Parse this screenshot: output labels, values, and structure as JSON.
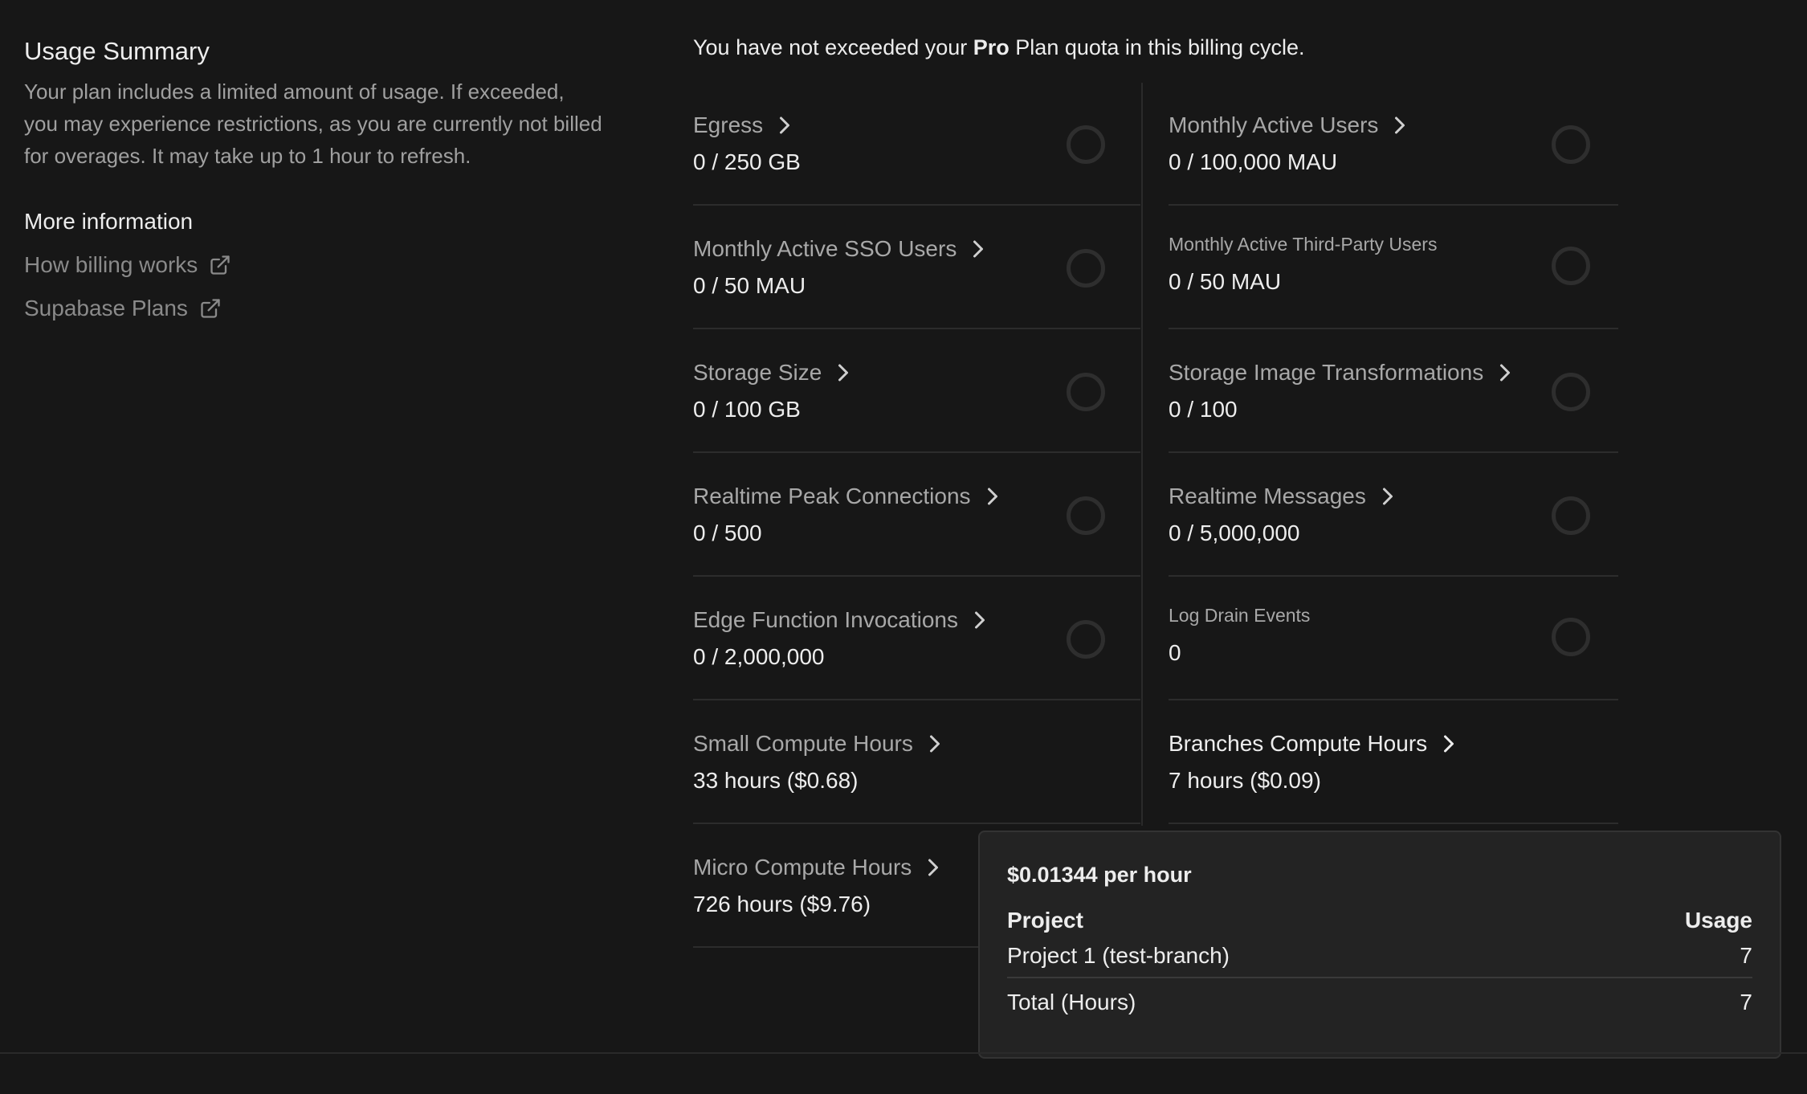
{
  "sidebar": {
    "title": "Usage Summary",
    "description": "Your plan includes a limited amount of usage. If exceeded, you may experience restrictions, as you are currently not billed for overages. It may take up to 1 hour to refresh.",
    "more_heading": "More information",
    "links": [
      {
        "label": "How billing works",
        "icon": "external-link-icon"
      },
      {
        "label": "Supabase Plans",
        "icon": "external-link-icon"
      }
    ]
  },
  "notice": {
    "prefix": "You have not exceeded your ",
    "plan": "Pro",
    "suffix": " Plan quota in this billing cycle."
  },
  "metrics": [
    {
      "label": "Egress",
      "value": "0 / 250 GB",
      "chevron": true,
      "usage_fraction": 0
    },
    {
      "label": "Monthly Active Users",
      "value": "0 / 100,000 MAU",
      "chevron": true,
      "usage_fraction": 0
    },
    {
      "label": "Monthly Active SSO Users",
      "value": "0 / 50 MAU",
      "chevron": true,
      "usage_fraction": 0
    },
    {
      "label": "Monthly Active Third-Party Users",
      "value": "0 / 50 MAU",
      "chevron": false,
      "usage_fraction": 0
    },
    {
      "label": "Storage Size",
      "value": "0 / 100 GB",
      "chevron": true,
      "usage_fraction": 0
    },
    {
      "label": "Storage Image Transformations",
      "value": "0 / 100",
      "chevron": true,
      "usage_fraction": 0
    },
    {
      "label": "Realtime Peak Connections",
      "value": "0 / 500",
      "chevron": true,
      "usage_fraction": 0
    },
    {
      "label": "Realtime Messages",
      "value": "0 / 5,000,000",
      "chevron": true,
      "usage_fraction": 0
    },
    {
      "label": "Edge Function Invocations",
      "value": "0 / 2,000,000",
      "chevron": true,
      "usage_fraction": 0
    },
    {
      "label": "Log Drain Events",
      "value": "0",
      "chevron": false,
      "usage_fraction": 0
    },
    {
      "label": "Small Compute Hours",
      "value": "33 hours ($0.68)",
      "chevron": true
    },
    {
      "label": "Branches Compute Hours",
      "value": "7 hours ($0.09)",
      "chevron": true
    },
    {
      "label": "Micro Compute Hours",
      "value": "726 hours ($9.76)",
      "chevron": true
    }
  ],
  "tooltip": {
    "rate": "$0.01344 per hour",
    "col_project": "Project",
    "col_usage": "Usage",
    "rows": [
      {
        "project": "Project 1 (test-branch)",
        "usage": "7"
      }
    ],
    "total_label": "Total (Hours)",
    "total_value": "7"
  }
}
